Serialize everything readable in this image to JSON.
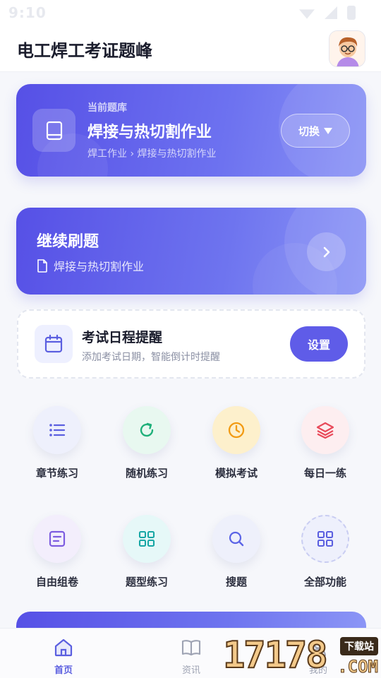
{
  "status_bar": {
    "time": "9:10"
  },
  "header": {
    "title": "电工焊工考证题峰"
  },
  "question_bank": {
    "label": "当前题库",
    "name": "焊接与热切割作业",
    "path": "焊工作业 › 焊接与热切割作业",
    "switch_label": "切换"
  },
  "continue_practice": {
    "title": "继续刷题",
    "subtitle": "焊接与热切割作业"
  },
  "exam_reminder": {
    "title": "考试日程提醒",
    "subtitle": "添加考试日期，智能倒计时提醒",
    "button_label": "设置"
  },
  "features": [
    {
      "label": "章节练习",
      "icon": "list-icon",
      "color": "#5b5fe0"
    },
    {
      "label": "随机练习",
      "icon": "refresh-icon",
      "color": "#1fb07a"
    },
    {
      "label": "模拟考试",
      "icon": "clock-icon",
      "color": "#f29a12"
    },
    {
      "label": "每日一练",
      "icon": "layers-icon",
      "color": "#e84a5a"
    },
    {
      "label": "自由组卷",
      "icon": "paper-icon",
      "color": "#7d5ce0"
    },
    {
      "label": "题型练习",
      "icon": "grid-icon",
      "color": "#18a7a5"
    },
    {
      "label": "搜题",
      "icon": "search-icon",
      "color": "#5b64e6"
    },
    {
      "label": "全部功能",
      "icon": "apps-icon",
      "color": "#5b5fe0"
    }
  ],
  "tabbar": {
    "tabs": [
      {
        "label": "首页",
        "icon": "home-icon"
      },
      {
        "label": "资讯",
        "icon": "book-icon"
      },
      {
        "label": "我的",
        "icon": "user-icon"
      }
    ],
    "active_color": "#5b5fe0",
    "inactive_color": "#9ea3b3"
  },
  "watermark": {
    "number": "17178",
    "badge": "下载站",
    "suffix": ".COM"
  }
}
